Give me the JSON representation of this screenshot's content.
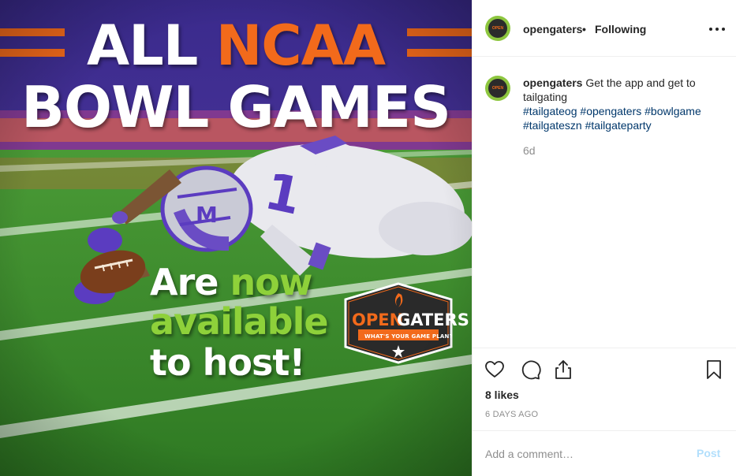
{
  "post_image": {
    "headline_1_part_1": "ALL ",
    "headline_1_part_2": "NCAA",
    "headline_2": "BOWL GAMES",
    "sub_1_part_1": "Are ",
    "sub_1_part_2": "now",
    "sub_2": "available",
    "sub_3": "to host!",
    "logo_word_1": "OPEN",
    "logo_word_2": "GATERS",
    "logo_tagline": "WHAT'S YOUR GAME PLAN?",
    "jersey_number": "1",
    "colors": {
      "orange": "#f26a1b",
      "green": "#8ed13a",
      "purple": "#4b2e9e",
      "turf": "#3f8f2c"
    }
  },
  "header": {
    "username": "opengaters",
    "separator": "•",
    "follow_status": "Following",
    "more_icon": "more-horizontal-icon"
  },
  "caption": {
    "username": "opengaters",
    "text": "Get the app and get to tailgating",
    "hashtags": [
      "#tailgateog",
      "#opengaters",
      "#bowlgame",
      "#tailgateszn",
      "#tailgateparty"
    ],
    "age": "6d"
  },
  "actions": {
    "icons": [
      "heart-icon",
      "comment-icon",
      "share-icon",
      "bookmark-icon"
    ]
  },
  "likes": "8 likes",
  "date": "6 DAYS AGO",
  "comment_box": {
    "placeholder": "Add a comment…",
    "post_label": "Post",
    "post_color": "#b2dffc"
  }
}
